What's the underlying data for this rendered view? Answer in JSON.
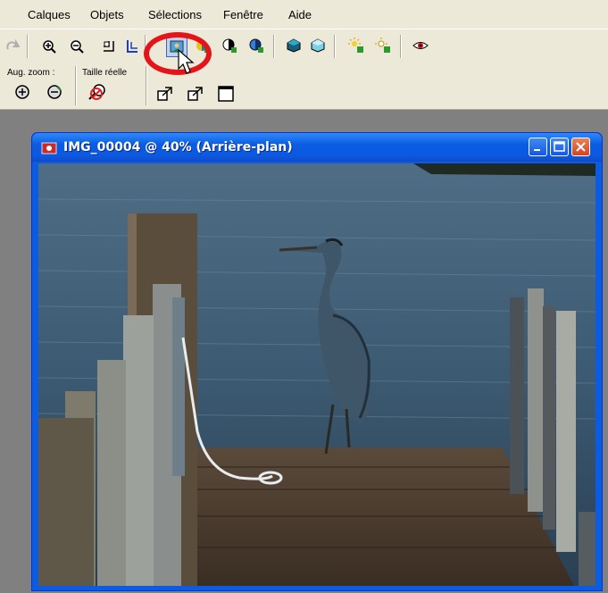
{
  "menubar": {
    "items": [
      {
        "label": "Calques"
      },
      {
        "label": "Objets"
      },
      {
        "label": "Sélections"
      },
      {
        "label": "Fenêtre"
      },
      {
        "label": "Aide"
      }
    ]
  },
  "toolbar": {
    "zoom_in_label": "Aug. zoom :",
    "actual_size_label": "Taille réelle"
  },
  "window": {
    "title": "IMG_00004 @  40% (Arrière-plan)"
  },
  "colors": {
    "highlight": "#e3151a",
    "titlebar": "#0a5ce3"
  }
}
